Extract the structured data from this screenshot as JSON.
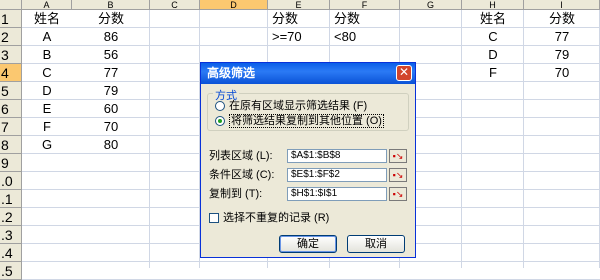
{
  "columns": [
    "A",
    "B",
    "C",
    "D",
    "E",
    "F",
    "G",
    "H",
    "I"
  ],
  "rows": [
    "1",
    "2",
    "3",
    "4",
    "5",
    "6",
    "7",
    "8",
    "9",
    ".0",
    ".1",
    ".2",
    ".3",
    ".4",
    ".5"
  ],
  "cells": {
    "A1": "姓名",
    "B1": "分数",
    "A2": "A",
    "B2": "86",
    "A3": "B",
    "B3": "56",
    "A4": "C",
    "B4": "77",
    "A5": "D",
    "B5": "79",
    "A6": "E",
    "B6": "60",
    "A7": "F",
    "B7": "70",
    "A8": "G",
    "B8": "80",
    "E1": "分数",
    "F1": "分数",
    "E2": ">=70",
    "F2": "<80",
    "H1": "姓名",
    "I1": "分数",
    "H2": "C",
    "I2": "77",
    "H3": "D",
    "I3": "79",
    "H4": "F",
    "I4": "70"
  },
  "dialog": {
    "title": "高级筛选",
    "close": "✕",
    "group_label": "方式",
    "radio1": "在原有区域显示筛选结果 (F)",
    "radio2": "将筛选结果复制到其他位置 (O)",
    "list_label": "列表区域 (L):",
    "list_value": "$A$1:$B$8",
    "criteria_label": "条件区域 (C):",
    "criteria_value": "$E$1:$F$2",
    "copy_label": "复制到 (T):",
    "copy_value": "$H$1:$I$1",
    "unique_label": "选择不重复的记录 (R)",
    "ok": "确定",
    "cancel": "取消",
    "ref_icon": "▪↘"
  }
}
